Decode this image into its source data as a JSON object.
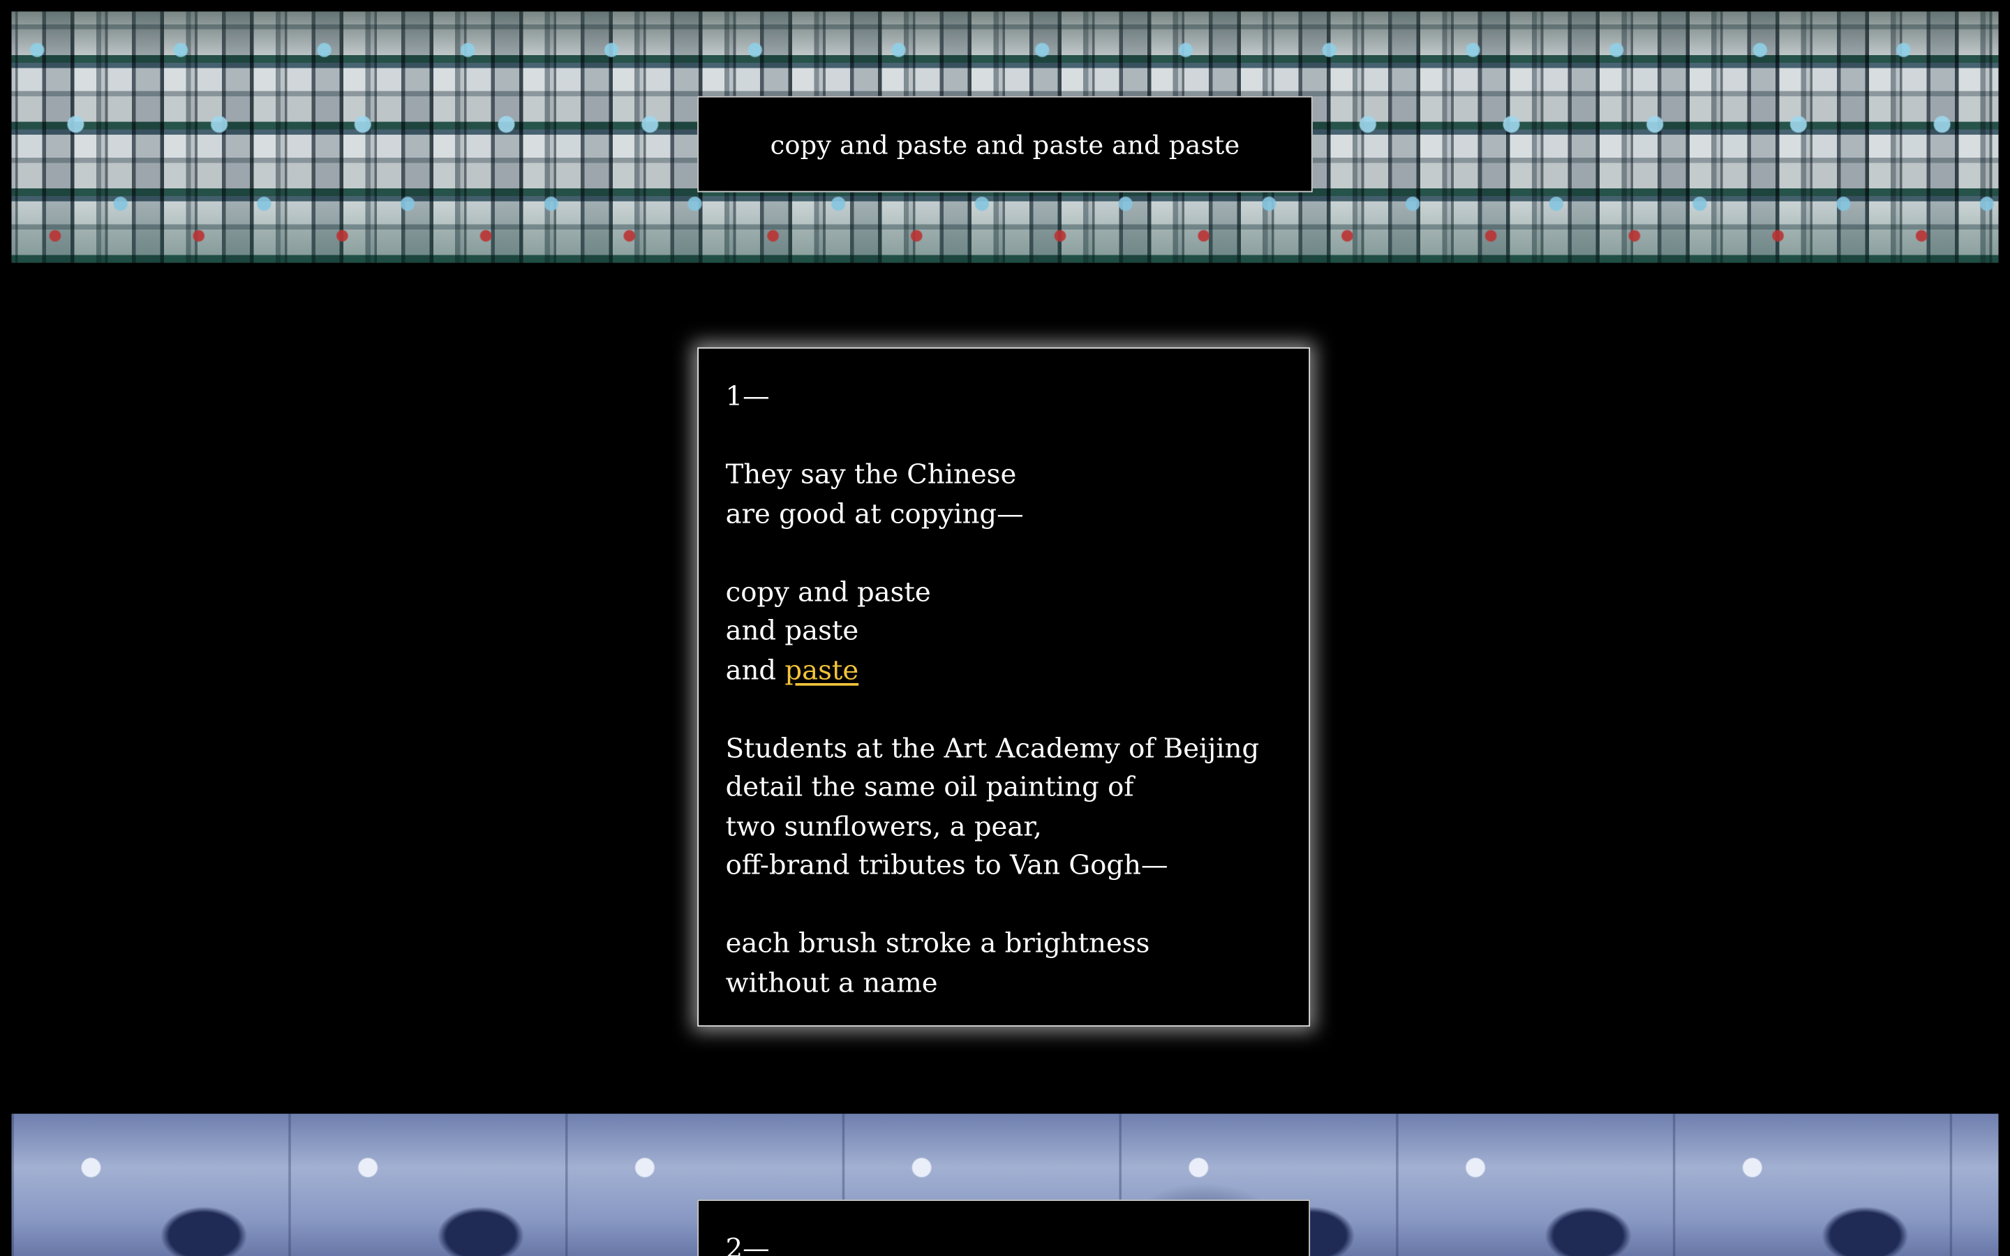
{
  "header": {
    "title": "copy and paste and paste and paste"
  },
  "poem1": {
    "number": "1—",
    "lines": [
      "They say the Chinese",
      "are good at copying—",
      "copy and paste",
      "and paste",
      "and ",
      "Students at the Art Academy of Beijing",
      "detail the same oil painting of",
      "two sunflowers, a pear,",
      "off-brand tributes to Van Gogh—",
      "each brush stroke a brightness",
      "without a name"
    ],
    "link_text": "paste",
    "link_color": "#f2c43a"
  },
  "poem2": {
    "number": "2—"
  }
}
